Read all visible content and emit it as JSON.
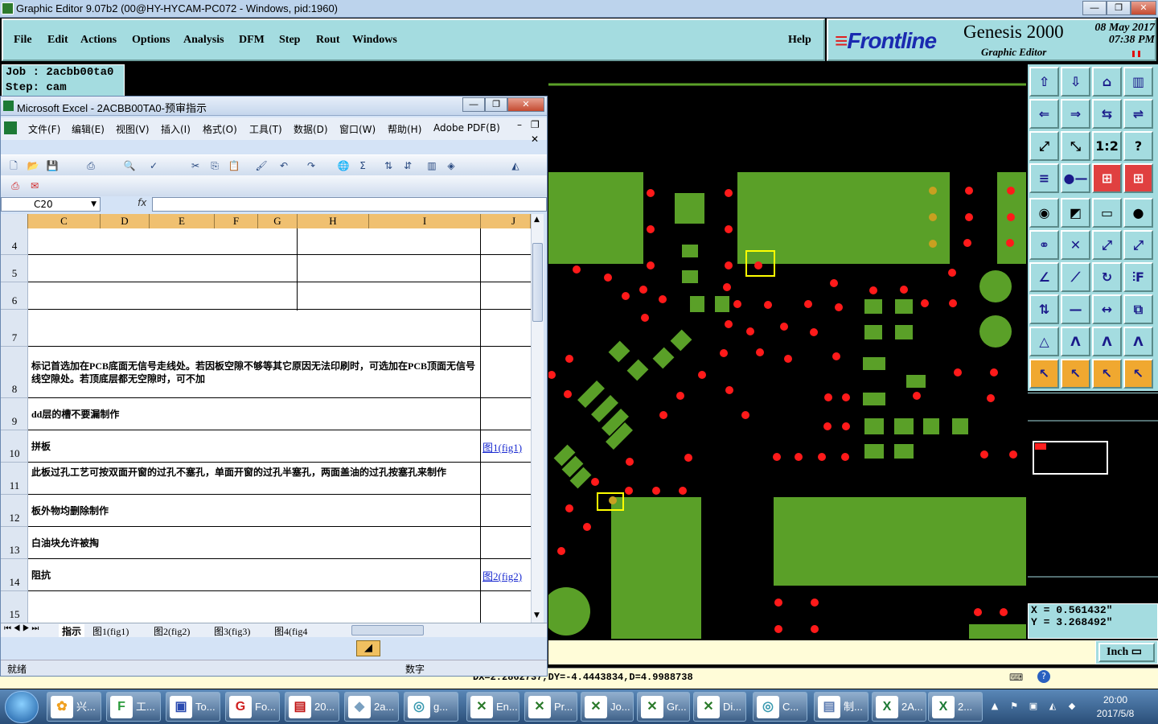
{
  "genesis": {
    "window_title": "Graphic Editor 9.07b2 (00@HY-HYCAM-PC072 - Windows, pid:1960)",
    "title_buttons": [
      "—",
      "❐",
      "✕"
    ],
    "menus": [
      "File",
      "Edit",
      "Actions",
      "Options",
      "Analysis",
      "DFM",
      "Step",
      "Rout",
      "Windows"
    ],
    "help": "Help",
    "brand": {
      "logo": "Frontline",
      "product": "Genesis 2000",
      "subtitle": "Graphic Editor",
      "date": "08 May 2017",
      "time": "07:38 PM"
    },
    "job_label": "Job  :  2acbb00ta0",
    "step_label": "Step:  cam",
    "coords": {
      "x": "X = 0.561432\"",
      "y": "Y = 3.268492\""
    },
    "unit": "Inch",
    "status_line": "DX=2.2862737,DY=-4.4443834,D=4.9988738",
    "tool_glyphs": [
      [
        "⇧",
        "⇩",
        "⌂",
        "▥"
      ],
      [
        "⇐",
        "⇒",
        "⇆",
        "⇌"
      ],
      [
        "⤢",
        "⤡",
        "1:2",
        "?"
      ],
      [
        "≡",
        "●—",
        "⊞",
        "⊞"
      ],
      [
        "◉",
        "◩",
        "▭",
        "●"
      ],
      [
        "⚭",
        "✕",
        "⤢",
        "⤢"
      ],
      [
        "∠",
        "⟋",
        "↻",
        "⫶F"
      ],
      [
        "⇅",
        "—",
        "↔",
        "⧉"
      ],
      [
        "△",
        "Λ",
        "Λ",
        "Λ"
      ],
      [
        "↖",
        "↖",
        "↖",
        "↖"
      ]
    ],
    "colors": {
      "panel": "#a4dce0",
      "copper": "#5aa028",
      "pad": "#ff1a1a",
      "select": "#ffff00"
    }
  },
  "excel": {
    "title": "Microsoft Excel - 2ACBB00TA0-预审指示",
    "menus": [
      "文件(F)",
      "编辑(E)",
      "视图(V)",
      "插入(I)",
      "格式(O)",
      "工具(T)",
      "数据(D)",
      "窗口(W)",
      "帮助(H)",
      "Adobe PDF(B)"
    ],
    "name_box": "C20",
    "fx": "fx",
    "columns": [
      "C",
      "D",
      "E",
      "F",
      "G",
      "H",
      "I",
      "J"
    ],
    "rows": [
      {
        "num": "4",
        "text": "",
        "link": ""
      },
      {
        "num": "5",
        "text": "",
        "link": ""
      },
      {
        "num": "6",
        "text": "",
        "link": ""
      },
      {
        "num": "7",
        "text": "",
        "link": ""
      },
      {
        "num": "8",
        "text": "标记首选加在PCB底面无信号走线处。若因板空隙不够等其它原因无法印刷时，可选加在PCB顶面无信号线空隙处。若顶底层都无空隙时，可不加",
        "link": ""
      },
      {
        "num": "9",
        "text": "dd层的槽不要漏制作",
        "link": ""
      },
      {
        "num": "10",
        "text": "拼板",
        "link": "图1(fig1)"
      },
      {
        "num": "11",
        "text": "此板过孔工艺可按双面开窗的过孔不塞孔，单面开窗的过孔半塞孔，两面盖油的过孔按塞孔来制作",
        "link": ""
      },
      {
        "num": "12",
        "text": "板外物均删除制作",
        "link": ""
      },
      {
        "num": "13",
        "text": "白油块允许被掏",
        "link": ""
      },
      {
        "num": "14",
        "text": "阻抗",
        "link": "图2(fig2)"
      },
      {
        "num": "15",
        "text": "",
        "link": ""
      }
    ],
    "sheet_tabs": [
      "指示",
      "图1(fig1)",
      "图2(fig2)",
      "图3(fig3)",
      "图4(fig4"
    ],
    "status": "就绪",
    "status_num": "数字"
  },
  "taskbar": {
    "items": [
      {
        "label": "兴...",
        "icon": "✿",
        "color": "#f0a020"
      },
      {
        "label": "工...",
        "icon": "F",
        "color": "#2a9a3a"
      },
      {
        "label": "To...",
        "icon": "▣",
        "color": "#2a4ab0"
      },
      {
        "label": "Fo...",
        "icon": "G",
        "color": "#d02020"
      },
      {
        "label": "20...",
        "icon": "▤",
        "color": "#c01010"
      },
      {
        "label": "2a...",
        "icon": "◆",
        "color": "#7aa0c0"
      },
      {
        "label": "g...",
        "icon": "◎",
        "color": "#3a9ab0"
      },
      {
        "label": "En...",
        "icon": "✕",
        "color": "#2a7a2a"
      },
      {
        "label": "Pr...",
        "icon": "✕",
        "color": "#2a7a2a"
      },
      {
        "label": "Jo...",
        "icon": "✕",
        "color": "#2a7a2a"
      },
      {
        "label": "Gr...",
        "icon": "✕",
        "color": "#2a7a2a"
      },
      {
        "label": "Di...",
        "icon": "✕",
        "color": "#2a7a2a"
      },
      {
        "label": "C...",
        "icon": "◎",
        "color": "#3a9ab0"
      },
      {
        "label": "制...",
        "icon": "▤",
        "color": "#5a7ab0"
      },
      {
        "label": "2A...",
        "icon": "X",
        "color": "#1d7a35"
      },
      {
        "label": "2...",
        "icon": "X",
        "color": "#1d7a35"
      }
    ],
    "time": "20:00",
    "date": "2017/5/8"
  }
}
